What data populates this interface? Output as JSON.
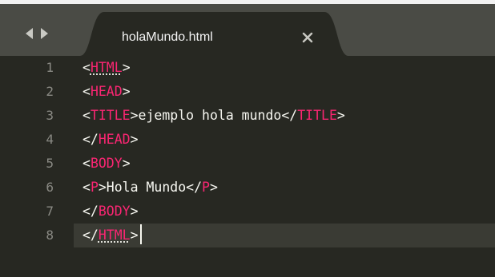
{
  "tab": {
    "title": "holaMundo.html"
  },
  "editor": {
    "line_numbers": [
      "1",
      "2",
      "3",
      "4",
      "5",
      "6",
      "7",
      "8"
    ],
    "lines": [
      {
        "open": "<",
        "tag": "HTML",
        "close": ">"
      },
      {
        "open": "<",
        "tag": "HEAD",
        "close": ">"
      },
      {
        "open": "<",
        "tag": "TITLE",
        "mid": ">ejemplo hola mundo</",
        "tag2": "TITLE",
        "close": ">"
      },
      {
        "open": "</",
        "tag": "HEAD",
        "close": ">"
      },
      {
        "open": "<",
        "tag": "BODY",
        "close": ">"
      },
      {
        "open": "<",
        "tag": "P",
        "mid": ">Hola Mundo</",
        "tag2": "P",
        "close": ">"
      },
      {
        "open": "</",
        "tag": "BODY",
        "close": ">"
      },
      {
        "open": "</",
        "tag": "HTML",
        "close": ">"
      }
    ],
    "current_line": "8"
  },
  "colors": {
    "editor_background": "#272822",
    "tab_bar": "#4a4b45",
    "tag": "#f92672",
    "text": "#f8f8f2",
    "line_number": "#8a8a84",
    "current_line": "#3a3b34"
  },
  "icons": {
    "navigation_left": "triangle-left-icon",
    "navigation_right": "triangle-right-icon",
    "tab_close": "close-icon"
  }
}
